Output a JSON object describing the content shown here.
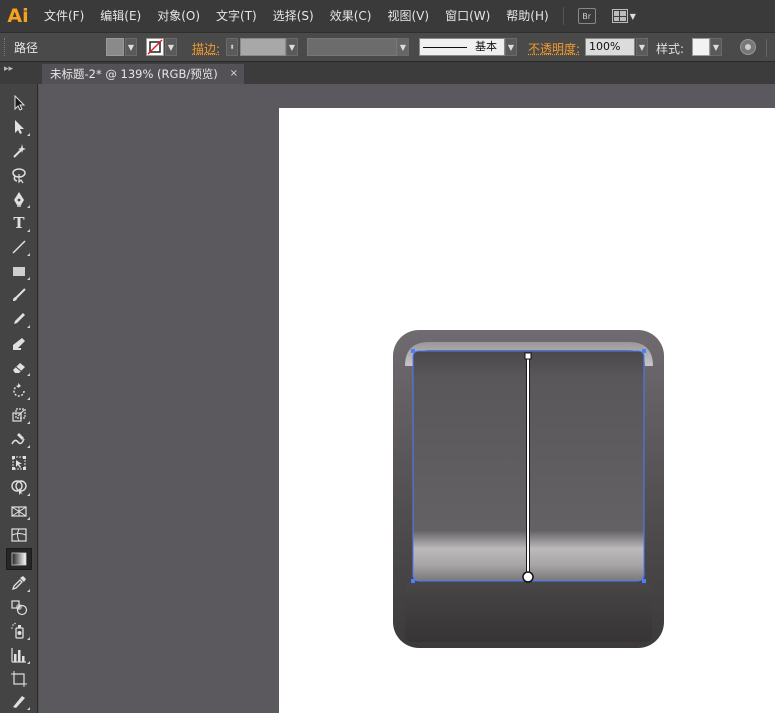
{
  "app": {
    "logo": "Ai"
  },
  "menu": {
    "items": [
      "文件(F)",
      "编辑(E)",
      "对象(O)",
      "文字(T)",
      "选择(S)",
      "效果(C)",
      "视图(V)",
      "窗口(W)",
      "帮助(H)"
    ],
    "bridge_label": "Br"
  },
  "control_bar": {
    "selection_label": "路径",
    "stroke_label": "描边:",
    "brush_label": "基本",
    "opacity_label": "不透明度:",
    "opacity_value": "100%",
    "style_label": "样式:"
  },
  "document_tab": {
    "title": "未标题-2* @ 139% (RGB/预览)",
    "close": "×"
  },
  "colors": {
    "accent": "#f39a2b",
    "logo": "#f7a21e",
    "selection": "#4a7dff",
    "artboard": "#ffffff",
    "canvas": "#5b595d"
  },
  "tools": [
    "selection-tool-icon",
    "direct-selection-tool-icon",
    "magic-wand-tool-icon",
    "lasso-tool-icon",
    "pen-tool-icon",
    "type-tool-icon",
    "line-segment-tool-icon",
    "rectangle-tool-icon",
    "paintbrush-tool-icon",
    "pencil-tool-icon",
    "blob-brush-tool-icon",
    "eraser-tool-icon",
    "rotate-tool-icon",
    "scale-tool-icon",
    "warp-tool-icon",
    "free-transform-tool-icon",
    "shape-builder-tool-icon",
    "perspective-grid-tool-icon",
    "mesh-tool-icon",
    "gradient-tool-icon",
    "eyedropper-tool-icon",
    "blend-tool-icon",
    "symbol-sprayer-tool-icon",
    "column-graph-tool-icon",
    "artboard-tool-icon",
    "slice-tool-icon"
  ],
  "active_tool": "gradient-tool-icon"
}
